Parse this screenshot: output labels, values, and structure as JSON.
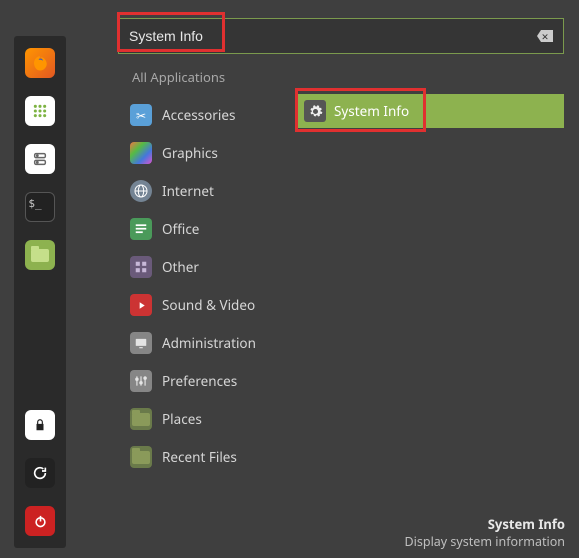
{
  "search": {
    "value": "System Info"
  },
  "categories": {
    "all": "All Applications",
    "items": [
      {
        "label": "Accessories"
      },
      {
        "label": "Graphics"
      },
      {
        "label": "Internet"
      },
      {
        "label": "Office"
      },
      {
        "label": "Other"
      },
      {
        "label": "Sound & Video"
      },
      {
        "label": "Administration"
      },
      {
        "label": "Preferences"
      },
      {
        "label": "Places"
      },
      {
        "label": "Recent Files"
      }
    ]
  },
  "result": {
    "label": "System Info"
  },
  "footer": {
    "title": "System Info",
    "desc": "Display system information"
  },
  "dock": [
    "firefox",
    "applications",
    "files",
    "terminal",
    "file-manager",
    "lock",
    "restart",
    "power"
  ]
}
